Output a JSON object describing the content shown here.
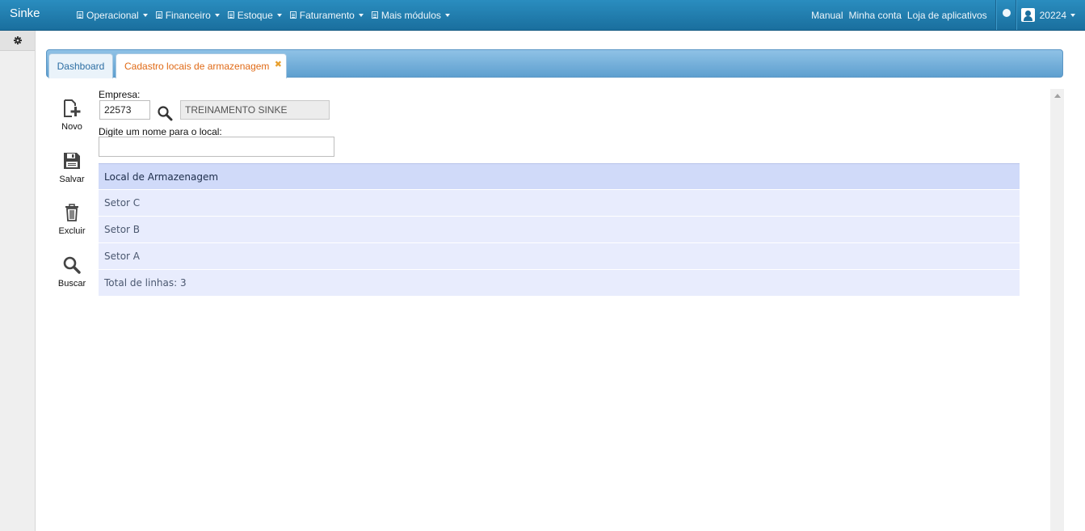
{
  "navbar": {
    "brand": "Sinke",
    "menu": [
      {
        "label": "Operacional"
      },
      {
        "label": "Financeiro"
      },
      {
        "label": "Estoque"
      },
      {
        "label": "Faturamento"
      },
      {
        "label": "Mais módulos"
      }
    ],
    "links": {
      "manual": "Manual",
      "account": "Minha conta",
      "store": "Loja de aplicativos"
    },
    "user": "20224"
  },
  "tabs": {
    "dashboard": "Dashboard",
    "active": "Cadastro locais de armazenagem",
    "close_icon": "✖"
  },
  "toolbar": {
    "new": "Novo",
    "save": "Salvar",
    "delete": "Excluir",
    "search": "Buscar"
  },
  "form": {
    "company_label": "Empresa:",
    "company_code": "22573",
    "company_name": "TREINAMENTO SINKE",
    "name_label": "Digite um nome para o local:",
    "name_value": ""
  },
  "grid": {
    "header": "Local de Armazenagem",
    "rows": [
      "Setor C",
      "Setor B",
      "Setor A"
    ],
    "total": "Total de linhas: 3"
  },
  "colors": {
    "navbar": "#1a6f9e",
    "active_tab_text": "#e06a16",
    "grid_header": "#d0daf9",
    "grid_row": "#e8ecfd"
  }
}
